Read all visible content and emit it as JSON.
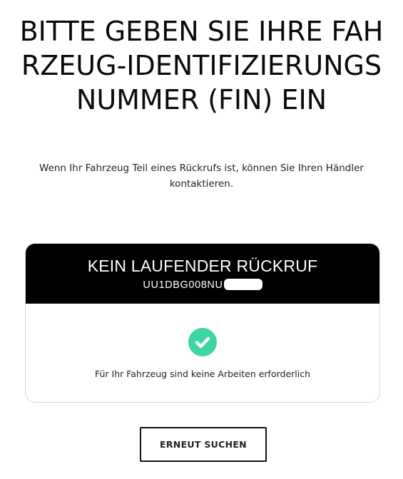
{
  "page": {
    "title": "BITTE GEBEN SIE IHRE FAHRZEUG-IDENTIFIZIERUNGSNUMMER (FIN) EIN",
    "subtitle": "Wenn Ihr Fahrzeug Teil eines Rückrufs ist, können Sie Ihren Händler kontaktieren."
  },
  "result_card": {
    "status_title": "KEIN LAUFENDER RÜCKRUF",
    "vin_visible": "UU1DBG008NU",
    "vin_redacted": true,
    "status_icon": "checkmark-circle-icon",
    "message": "Für Ihr Fahrzeug sind keine Arbeiten erforderlich"
  },
  "actions": {
    "search_again_label": "ERNEUT SUCHEN"
  },
  "colors": {
    "header_background": "#000000",
    "header_text": "#ffffff",
    "success_accent": "#3dd6a0",
    "card_border": "#d6d6d6",
    "button_border": "#111111"
  }
}
